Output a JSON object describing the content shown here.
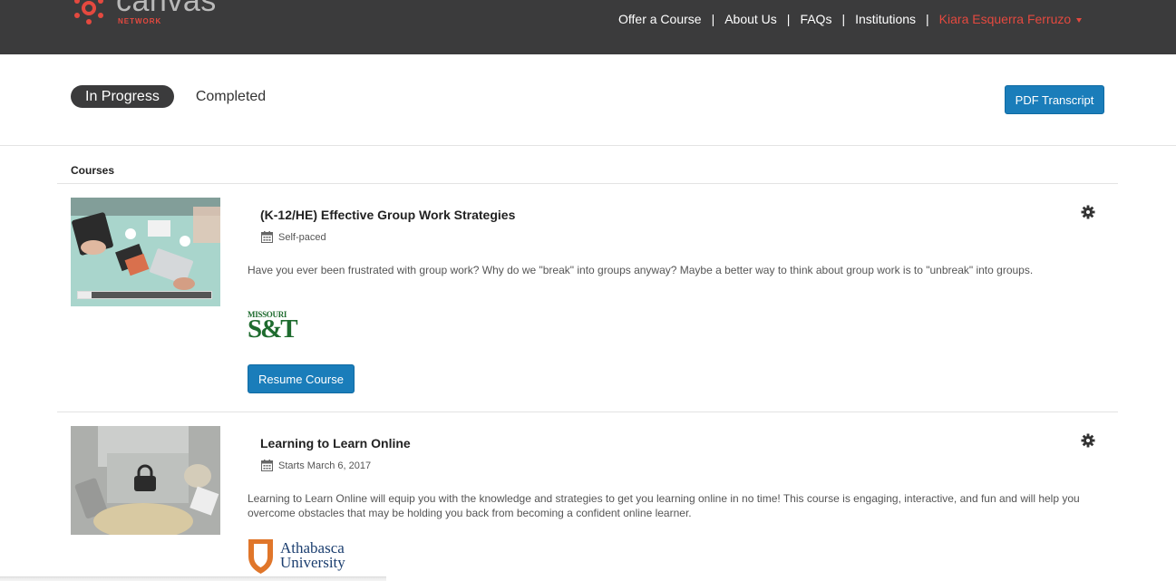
{
  "brand": {
    "wordmark": "canvas",
    "sub": "NETWORK",
    "accent": "#e4493f",
    "header_bg": "#3b3b3c"
  },
  "nav": {
    "items": [
      "Offer a Course",
      "About Us",
      "FAQs",
      "Institutions"
    ],
    "user": "Kiara Esquerra Ferruzo"
  },
  "tabs": {
    "active": "In Progress",
    "inactive": "Completed"
  },
  "pdf_button": "PDF Transcript",
  "courses_heading": "Courses",
  "courses": [
    {
      "title": "(K-12/HE) Effective Group Work Strategies",
      "meta": "Self-paced",
      "description": "Have you ever been frustrated with group work? Why do we \"break\" into groups anyway? Maybe a better way to think about group work is to \"unbreak\" into groups.",
      "institution_logo": {
        "line1": "MISSOURI",
        "line2": "S&T",
        "color": "#1e6b2e"
      },
      "action": "Resume Course",
      "progress": 0.1
    },
    {
      "title": "Learning to Learn Online",
      "meta": "Starts March 6, 2017",
      "description": "Learning to Learn Online will equip you with the knowledge and strategies to get you learning online in no time! This course is engaging, interactive, and fun and will help you overcome obstacles that may be holding you back from becoming a confident online learner.",
      "institution_logo": {
        "line1": "Athabasca",
        "line2": "University",
        "color": "#1b3e6f",
        "shield": "#e0762a"
      },
      "locked": true
    }
  ]
}
